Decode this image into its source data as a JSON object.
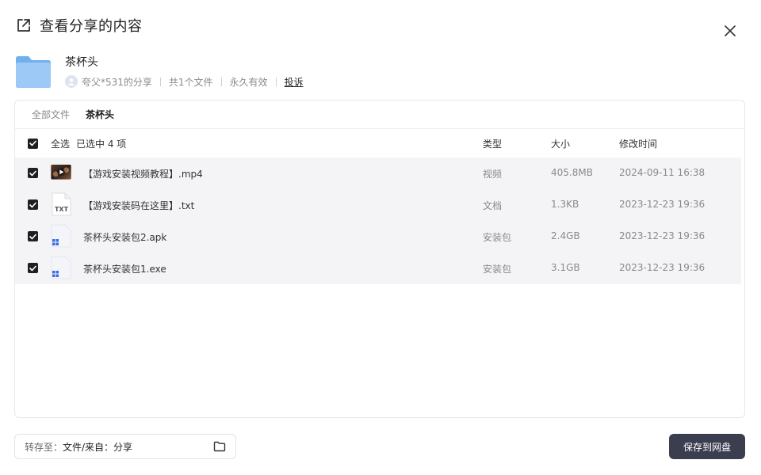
{
  "dialog": {
    "title": "查看分享的内容"
  },
  "share": {
    "folder_name": "茶杯头",
    "sharer": "夸父*531的分享",
    "file_count": "共1个文件",
    "validity": "永久有效",
    "report_label": "投诉"
  },
  "breadcrumb": {
    "root": "全部文件",
    "current": "茶杯头"
  },
  "table": {
    "select_all": "全选",
    "selected_count": "已选中  4  项",
    "headers": {
      "type": "类型",
      "size": "大小",
      "time": "修改时间"
    },
    "rows": [
      {
        "name": "【游戏安装视频教程】.mp4",
        "type": "视频",
        "size": "405.8MB",
        "time": "2024-09-11 16:38",
        "icon": "video-thumbnail",
        "checked": true
      },
      {
        "name": "【游戏安装码在这里】.txt",
        "type": "文档",
        "size": "1.3KB",
        "time": "2023-12-23 19:36",
        "icon": "txt-file-icon",
        "txt_label": "TXT",
        "checked": true
      },
      {
        "name": "茶杯头安装包2.apk",
        "type": "安装包",
        "size": "2.4GB",
        "time": "2023-12-23 19:36",
        "icon": "app-package-icon",
        "checked": true
      },
      {
        "name": "茶杯头安装包1.exe",
        "type": "安装包",
        "size": "3.1GB",
        "time": "2023-12-23 19:36",
        "icon": "app-package-icon",
        "checked": true
      }
    ]
  },
  "footer": {
    "save_to_label": "转存至：",
    "save_to_path": "文件/来自：分享",
    "save_button": "保存到网盘"
  },
  "colors": {
    "primary_button": "#3b3e4f",
    "folder": "#8fc1f5",
    "row_highlight": "#f4f4f6"
  }
}
